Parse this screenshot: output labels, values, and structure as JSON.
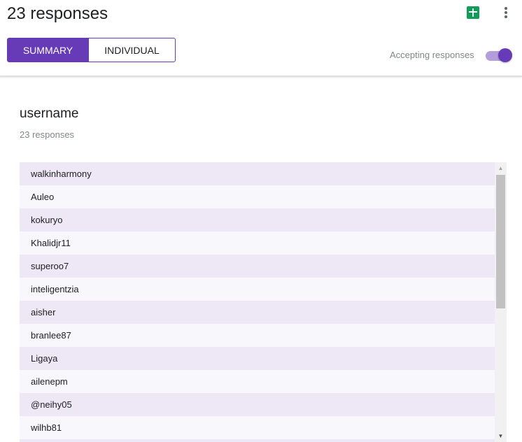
{
  "header": {
    "title": "23 responses",
    "sheets_icon": "google-sheets-icon",
    "more_icon": "more-vert-icon",
    "tabs": [
      {
        "label": "SUMMARY",
        "active": true
      },
      {
        "label": "INDIVIDUAL",
        "active": false
      }
    ],
    "accepting_label": "Accepting responses",
    "accepting_on": true
  },
  "question": {
    "title": "username",
    "count_label": "23 responses",
    "responses": [
      "walkinharmony",
      "Auleo",
      "kokuryo",
      "Khalidjr11",
      "superoo7",
      "inteligentzia",
      "aisher",
      "branlee87",
      "Ligaya",
      "ailenepm",
      "@neihy05",
      "wilhb81",
      ""
    ]
  },
  "colors": {
    "accent": "#673ab7",
    "accent_light": "#b39ddb",
    "row_odd": "#ede7f6",
    "row_even": "#f8f7fc",
    "sheets_green": "#0f9d58"
  }
}
